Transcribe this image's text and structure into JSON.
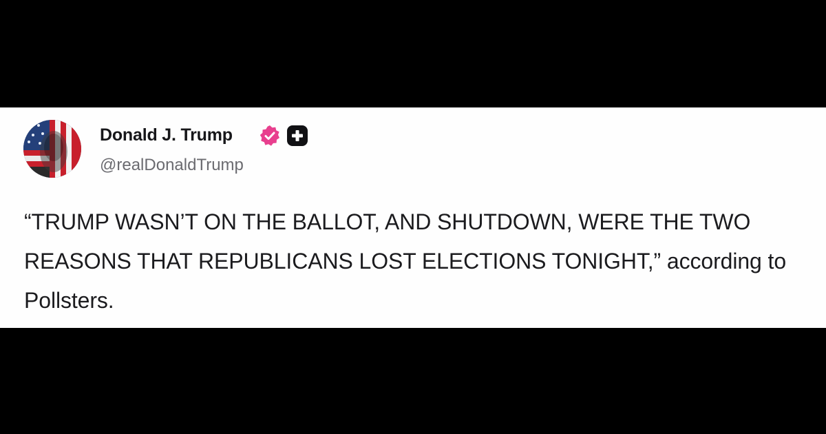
{
  "post": {
    "author": {
      "display_name": "Donald J. Trump",
      "handle": "@realDonaldTrump",
      "verified_icon": "verified-check-icon",
      "badge_icon": "plus-badge-icon"
    },
    "text": "“TRUMP WASN’T ON THE BALLOT, AND SHUTDOWN, WERE THE TWO REASONS THAT REPUBLICANS LOST ELECTIONS TONIGHT,” according to Pollsters."
  },
  "colors": {
    "background_bars": "#000000",
    "card": "#fefefe",
    "verified": "#e83f8e",
    "handle_text": "#6b6b70"
  }
}
